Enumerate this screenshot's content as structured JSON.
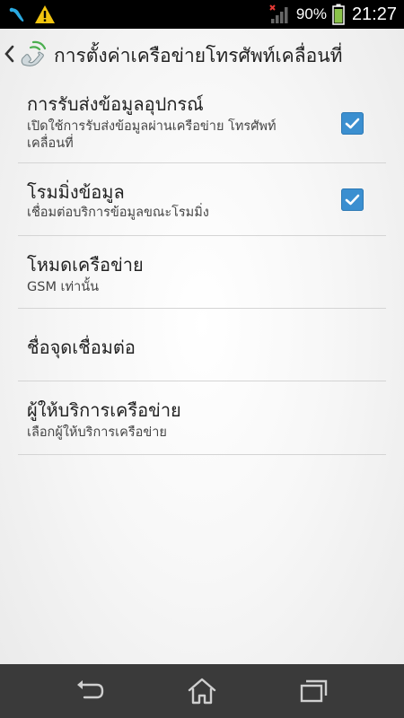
{
  "status_bar": {
    "icons_left": [
      "carrier-icon",
      "warning-icon"
    ],
    "icons_right": [
      "no-sim-signal-icon",
      "battery-icon"
    ],
    "battery_percent": "90%",
    "clock": "21:27"
  },
  "action_bar": {
    "title": "การตั้งค่าเครือข่ายโทรศัพท์เคลื่อนที่",
    "icon": "phone-settings-icon"
  },
  "preferences": [
    {
      "title": "การรับส่งข้อมูลอุปกรณ์",
      "summary": "เปิดใช้การรับส่งข้อมูลผ่านเครือข่าย โทรศัพท์เคลื่อนที่",
      "checked": true
    },
    {
      "title": "โรมมิ่งข้อมูล",
      "summary": "เชื่อมต่อบริการข้อมูลขณะโรมมิ่ง",
      "checked": true
    },
    {
      "title": "โหมดเครือข่าย",
      "summary": "GSM เท่านั้น"
    },
    {
      "title": "ชื่อจุดเชื่อมต่อ"
    },
    {
      "title": "ผู้ให้บริการเครือข่าย",
      "summary": "เลือกผู้ให้บริการเครือข่าย"
    }
  ],
  "nav_bar": {
    "buttons": [
      "back-icon",
      "home-icon",
      "recents-icon"
    ]
  },
  "colors": {
    "checkbox": "#3b8fd0",
    "navbar": "#3a3a3a",
    "divider": "#d4d4d4"
  }
}
